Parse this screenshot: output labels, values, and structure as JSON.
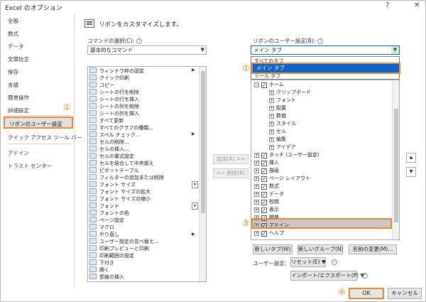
{
  "window": {
    "title": "Excel のオプション",
    "help_label": "?",
    "close_label": "✕"
  },
  "sidebar": {
    "items": [
      "全般",
      "数式",
      "データ",
      "文章校正",
      "保存",
      "言語",
      "簡単操作",
      "詳細設定",
      "リボンのユーザー設定",
      "クイック アクセス ツール バー",
      "アドイン",
      "トラスト センター"
    ],
    "selected_index": 8
  },
  "annotations": {
    "step1": "①",
    "step2": "②",
    "step3": "③",
    "step4": "④"
  },
  "header": {
    "text": "リボンをカスタマイズします。"
  },
  "commands": {
    "label": "コマンドの選択(C):",
    "selected": "基本的なコマンド",
    "items": [
      "ウィンドウ枠の固定",
      "クイック印刷",
      "コピー",
      "シートの行を削除",
      "シートの行を挿入",
      "シートの列を削除",
      "シートの列を挿入",
      "すべて更新",
      "すべてのグラフの種類...",
      "スペル チェック...",
      "セルの削除...",
      "セルの挿入...",
      "セルの書式設定",
      "セルを結合して中央揃え",
      "ピボットテーブル",
      "フィルターの追加または削除",
      "フォント サイズ",
      "フォント サイズの拡大",
      "フォント サイズの縮小",
      "フォント",
      "フォントの色",
      "ページ設定",
      "マクロ",
      "やり直し",
      "ユーザー設定の並べ替え...",
      "印刷プレビューと印刷",
      "印刷範囲の設定",
      "下付き",
      "開く",
      "罫線の挿入"
    ]
  },
  "mid_buttons": {
    "add": "追加(A) >>",
    "remove": "<< 削除(R)"
  },
  "ribbon": {
    "label": "リボンのユーザー設定(B):",
    "selected": "メイン タブ",
    "dropdown_options": [
      "すべてのタブ",
      "メイン タブ",
      "ツール タブ"
    ],
    "tree": [
      {
        "text": "ホーム",
        "level": 0,
        "pm": "⊟",
        "check": true
      },
      {
        "text": "クリップボード",
        "level": 1,
        "pm": "⊞",
        "check": false
      },
      {
        "text": "フォント",
        "level": 1,
        "pm": "⊞",
        "check": false
      },
      {
        "text": "配置",
        "level": 1,
        "pm": "⊞",
        "check": false
      },
      {
        "text": "数値",
        "level": 1,
        "pm": "⊞",
        "check": false
      },
      {
        "text": "スタイル",
        "level": 1,
        "pm": "⊞",
        "check": false
      },
      {
        "text": "セル",
        "level": 1,
        "pm": "⊞",
        "check": false
      },
      {
        "text": "編集",
        "level": 1,
        "pm": "⊞",
        "check": false
      },
      {
        "text": "アイデア",
        "level": 1,
        "pm": "⊞",
        "check": false
      },
      {
        "text": "タッチ (ユーザー設定)",
        "level": 0,
        "pm": "⊞",
        "check": true
      },
      {
        "text": "挿入",
        "level": 0,
        "pm": "⊞",
        "check": true
      },
      {
        "text": "描画",
        "level": 0,
        "pm": "⊞",
        "check": true
      },
      {
        "text": "ページ レイアウト",
        "level": 0,
        "pm": "⊞",
        "check": true
      },
      {
        "text": "数式",
        "level": 0,
        "pm": "⊞",
        "check": true
      },
      {
        "text": "データ",
        "level": 0,
        "pm": "⊞",
        "check": true
      },
      {
        "text": "校閲",
        "level": 0,
        "pm": "⊞",
        "check": true
      },
      {
        "text": "表示",
        "level": 0,
        "pm": "⊞",
        "check": true
      },
      {
        "text": "開発",
        "level": 0,
        "pm": "⊞",
        "check": true
      },
      {
        "text": "アドイン",
        "level": 0,
        "pm": "⊞",
        "check": true
      },
      {
        "text": "ヘルプ",
        "level": 0,
        "pm": "⊞",
        "check": true
      }
    ]
  },
  "ribbon_buttons": {
    "new_tab": "新しいタブ(W)",
    "new_group": "新しいグループ(N)",
    "rename": "名前の変更(M)..."
  },
  "user_settings": {
    "label": "ユーザー設定:",
    "reset": "リセット(E) ▼",
    "import_export": "インポート/エクスポート(P) ▼"
  },
  "footer": {
    "ok": "OK",
    "cancel": "キャンセル"
  },
  "colors": {
    "accent_orange": "#f0882e",
    "selection_blue": "#0a64d0"
  }
}
